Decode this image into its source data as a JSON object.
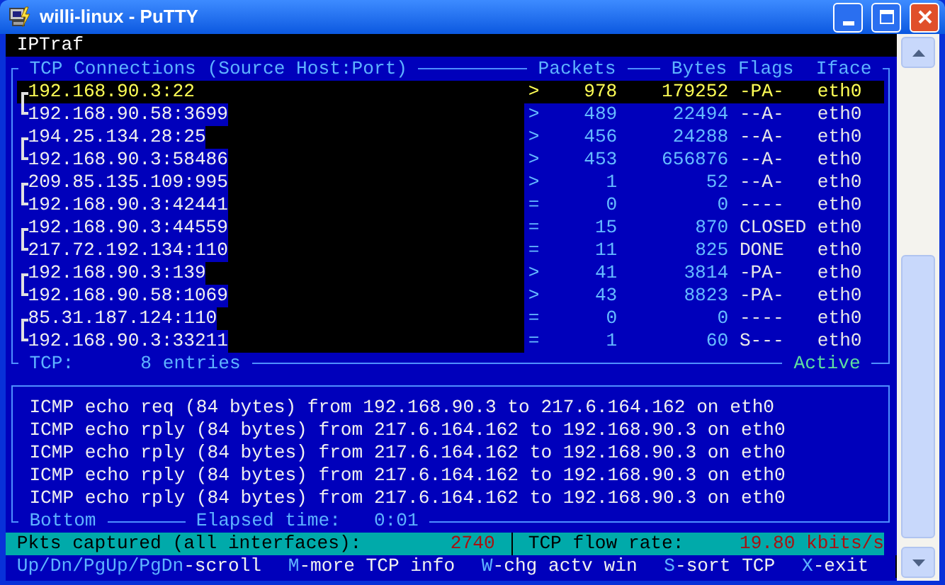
{
  "window": {
    "title": "willi-linux - PuTTY"
  },
  "app_title": "IPTraf",
  "tcp_panel": {
    "columns": [
      "TCP Connections (Source Host:Port)",
      "Packets",
      "Bytes",
      "Flags",
      "Iface"
    ],
    "rows": [
      {
        "address": "192.168.90.3:22",
        "direction": ">",
        "packets": "978",
        "bytes": "179252",
        "flags": "-PA-",
        "iface": "eth0",
        "kind": "start",
        "selected": true
      },
      {
        "address": "192.168.90.58:3699",
        "direction": ">",
        "packets": "489",
        "bytes": "22494",
        "flags": "--A-",
        "iface": "eth0",
        "kind": "end",
        "selected": false
      },
      {
        "address": "194.25.134.28:25",
        "direction": ">",
        "packets": "456",
        "bytes": "24288",
        "flags": "--A-",
        "iface": "eth0",
        "kind": "start",
        "selected": false
      },
      {
        "address": "192.168.90.3:58486",
        "direction": ">",
        "packets": "453",
        "bytes": "656876",
        "flags": "--A-",
        "iface": "eth0",
        "kind": "end",
        "selected": false
      },
      {
        "address": "209.85.135.109:995",
        "direction": ">",
        "packets": "1",
        "bytes": "52",
        "flags": "--A-",
        "iface": "eth0",
        "kind": "start",
        "selected": false
      },
      {
        "address": "192.168.90.3:42441",
        "direction": "=",
        "packets": "0",
        "bytes": "0",
        "flags": "----",
        "iface": "eth0",
        "kind": "end",
        "selected": false
      },
      {
        "address": "192.168.90.3:44559",
        "direction": "=",
        "packets": "15",
        "bytes": "870",
        "flags": "CLOSED",
        "iface": "eth0",
        "kind": "start",
        "selected": false
      },
      {
        "address": "217.72.192.134:110",
        "direction": "=",
        "packets": "11",
        "bytes": "825",
        "flags": "DONE",
        "iface": "eth0",
        "kind": "end",
        "selected": false
      },
      {
        "address": "192.168.90.3:139",
        "direction": ">",
        "packets": "41",
        "bytes": "3814",
        "flags": "-PA-",
        "iface": "eth0",
        "kind": "start",
        "selected": false
      },
      {
        "address": "192.168.90.58:1069",
        "direction": ">",
        "packets": "43",
        "bytes": "8823",
        "flags": "-PA-",
        "iface": "eth0",
        "kind": "end",
        "selected": false
      },
      {
        "address": "85.31.187.124:110",
        "direction": "=",
        "packets": "0",
        "bytes": "0",
        "flags": "----",
        "iface": "eth0",
        "kind": "start",
        "selected": false
      },
      {
        "address": "192.168.90.3:33211",
        "direction": "=",
        "packets": "1",
        "bytes": "60",
        "flags": "S---",
        "iface": "eth0",
        "kind": "end",
        "selected": false
      }
    ],
    "footer_label": "TCP:",
    "entry_count": "8 entries",
    "mode": "Active"
  },
  "icmp_panel": {
    "lines": [
      "ICMP echo req (84 bytes) from 192.168.90.3 to 217.6.164.162 on eth0",
      "ICMP echo rply (84 bytes) from 217.6.164.162 to 192.168.90.3 on eth0",
      "ICMP echo rply (84 bytes) from 217.6.164.162 to 192.168.90.3 on eth0",
      "ICMP echo rply (84 bytes) from 217.6.164.162 to 192.168.90.3 on eth0",
      "ICMP echo rply (84 bytes) from 217.6.164.162 to 192.168.90.3 on eth0"
    ],
    "footer": "Bottom",
    "elapsed_label": "Elapsed time:",
    "elapsed": "0:01"
  },
  "status_bar": {
    "packets_label": "Pkts captured (all interfaces):",
    "packets": "2740",
    "rate_label": "TCP flow rate:",
    "rate": "19.80 kbits/s"
  },
  "help": [
    {
      "key": "Up/Dn/PgUp/PgDn",
      "action": "-scroll"
    },
    {
      "key": "M",
      "action": "-more TCP info"
    },
    {
      "key": "W",
      "action": "-chg actv win"
    },
    {
      "key": "S",
      "action": "-sort TCP"
    },
    {
      "key": "X",
      "action": "-exit"
    }
  ]
}
